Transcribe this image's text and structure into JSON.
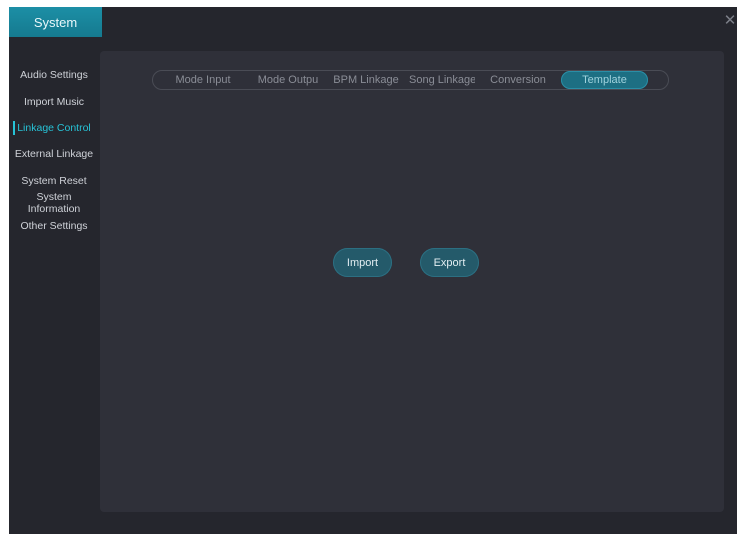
{
  "window": {
    "title": "System"
  },
  "sidebar": {
    "items": [
      {
        "label": "Audio Settings"
      },
      {
        "label": "Import Music"
      },
      {
        "label": "Linkage Control",
        "active": true
      },
      {
        "label": "External Linkage"
      },
      {
        "label": "System Reset"
      },
      {
        "label": "System\nInformation"
      },
      {
        "label": "Other Settings"
      }
    ]
  },
  "tabs": [
    {
      "label": "Mode Input"
    },
    {
      "label": "Mode Outpu"
    },
    {
      "label": "BPM Linkage"
    },
    {
      "label": "Song Linkage"
    },
    {
      "label": "Conversion"
    },
    {
      "label": "Template",
      "active": true
    }
  ],
  "actions": {
    "import_label": "Import",
    "export_label": "Export"
  },
  "colors": {
    "accent": "#27c2d6",
    "title_tab": "#1c8fa6",
    "button": "#245a6a"
  },
  "icons": {
    "close": "close-icon"
  }
}
